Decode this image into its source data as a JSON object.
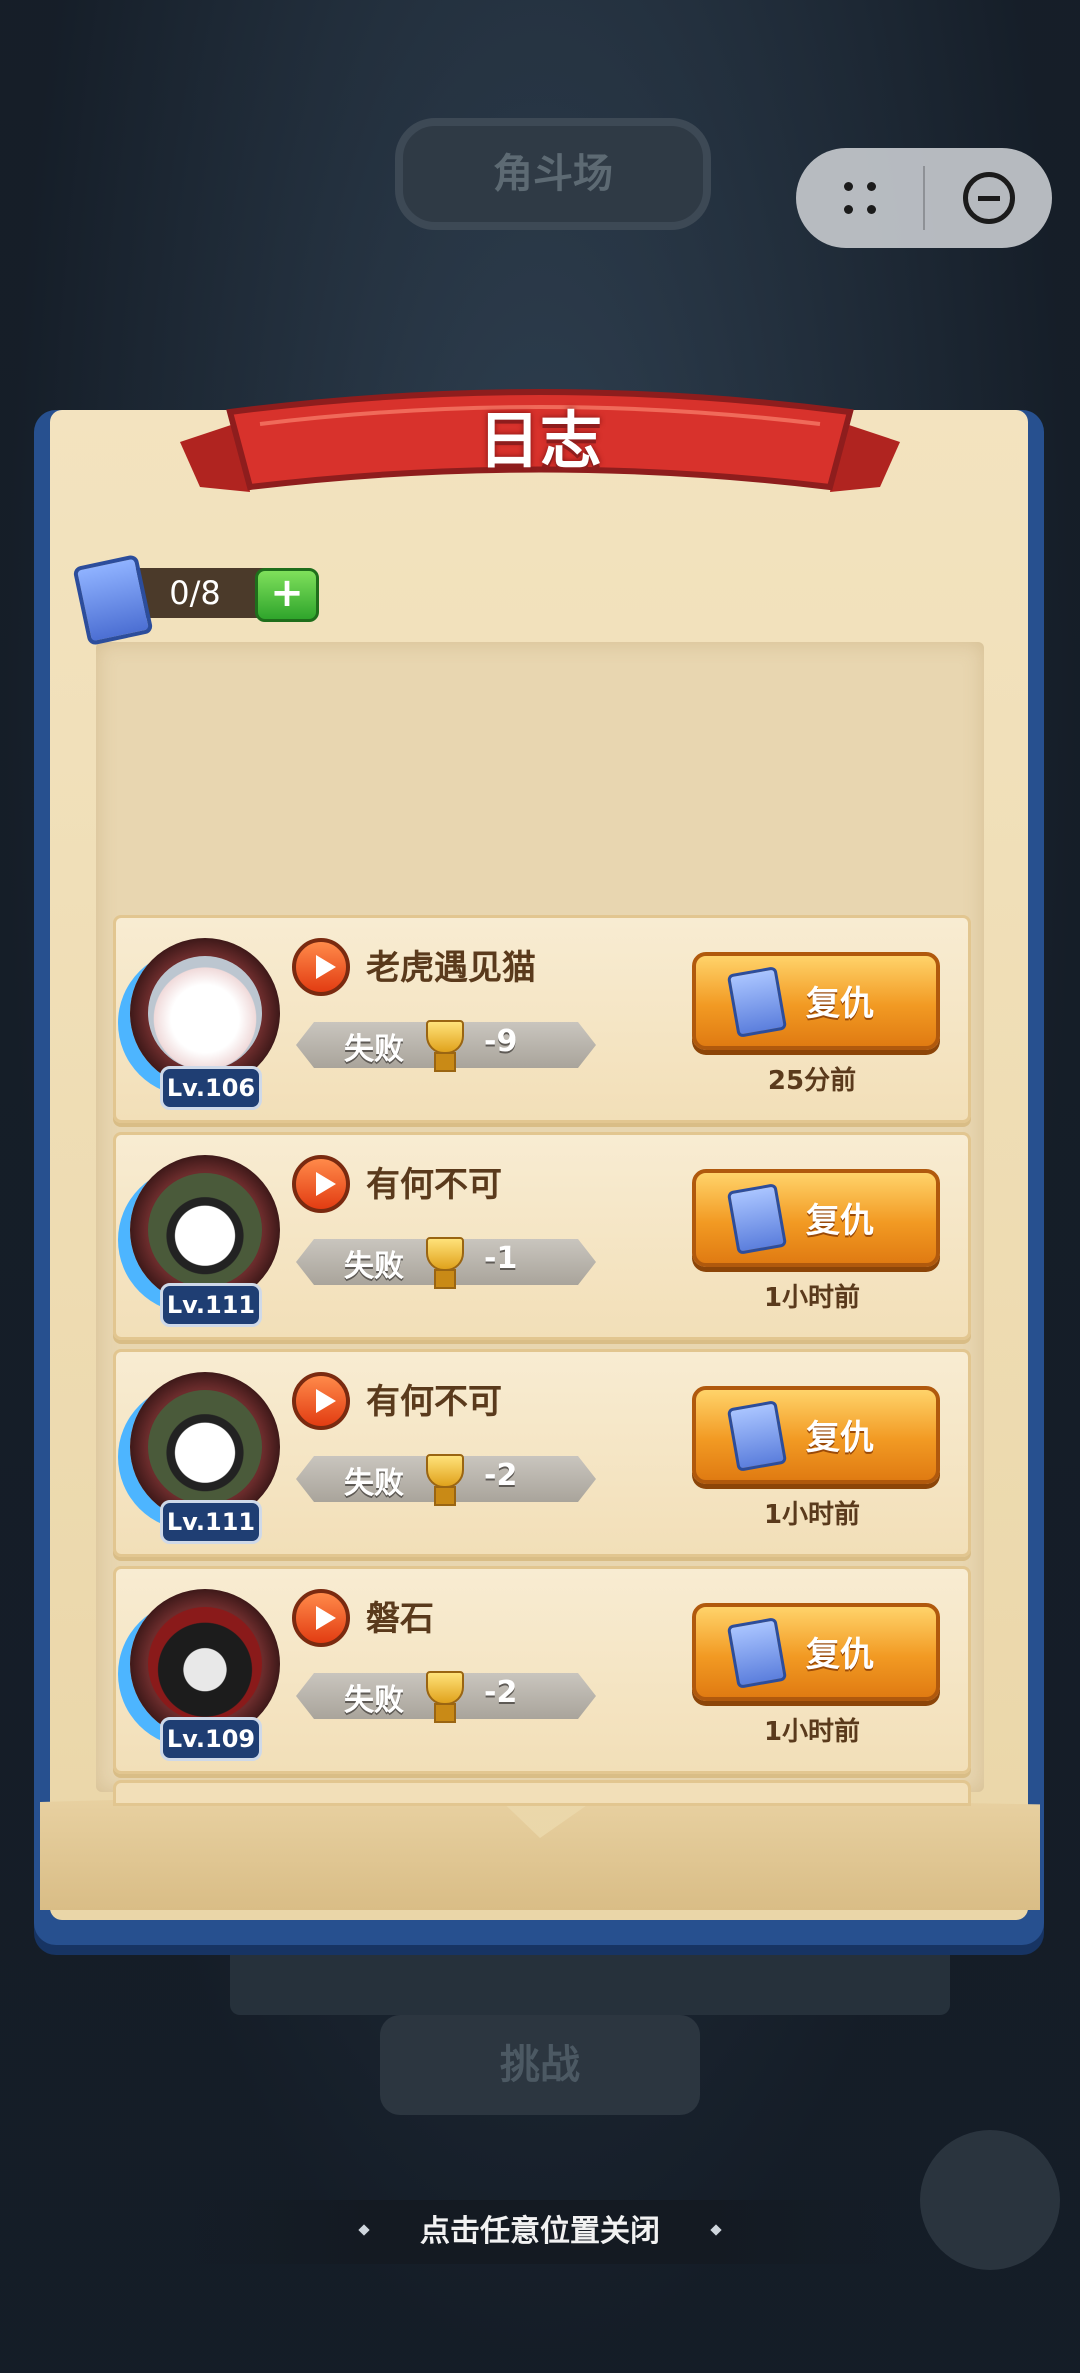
{
  "background": {
    "title_plaque": "角斗场",
    "challenge_button": "挑战"
  },
  "capsule": {
    "more_icon": "four-dot-icon",
    "close_icon": "minus-circle-icon"
  },
  "panel": {
    "title": "日志",
    "ticket_count": "0/8",
    "add_icon": "plus-icon"
  },
  "log_entries": [
    {
      "level": "Lv.106",
      "name": "老虎遇见猫",
      "result": "失败",
      "delta": "-9",
      "action": "复仇",
      "time": "25分前",
      "avatar": "fox"
    },
    {
      "level": "Lv.111",
      "name": "有何不可",
      "result": "失败",
      "delta": "-1",
      "action": "复仇",
      "time": "1小时前",
      "avatar": "panda"
    },
    {
      "level": "Lv.111",
      "name": "有何不可",
      "result": "失败",
      "delta": "-2",
      "action": "复仇",
      "time": "1小时前",
      "avatar": "panda"
    },
    {
      "level": "Lv.109",
      "name": "磐石",
      "result": "失败",
      "delta": "-2",
      "action": "复仇",
      "time": "1小时前",
      "avatar": "dark"
    }
  ],
  "footer": {
    "close_hint": "点击任意位置关闭"
  },
  "colors": {
    "frame_blue": "#27508f",
    "ribbon_red": "#d8322c",
    "button_orange": "#f29a23",
    "paper": "#f3e3bf"
  }
}
